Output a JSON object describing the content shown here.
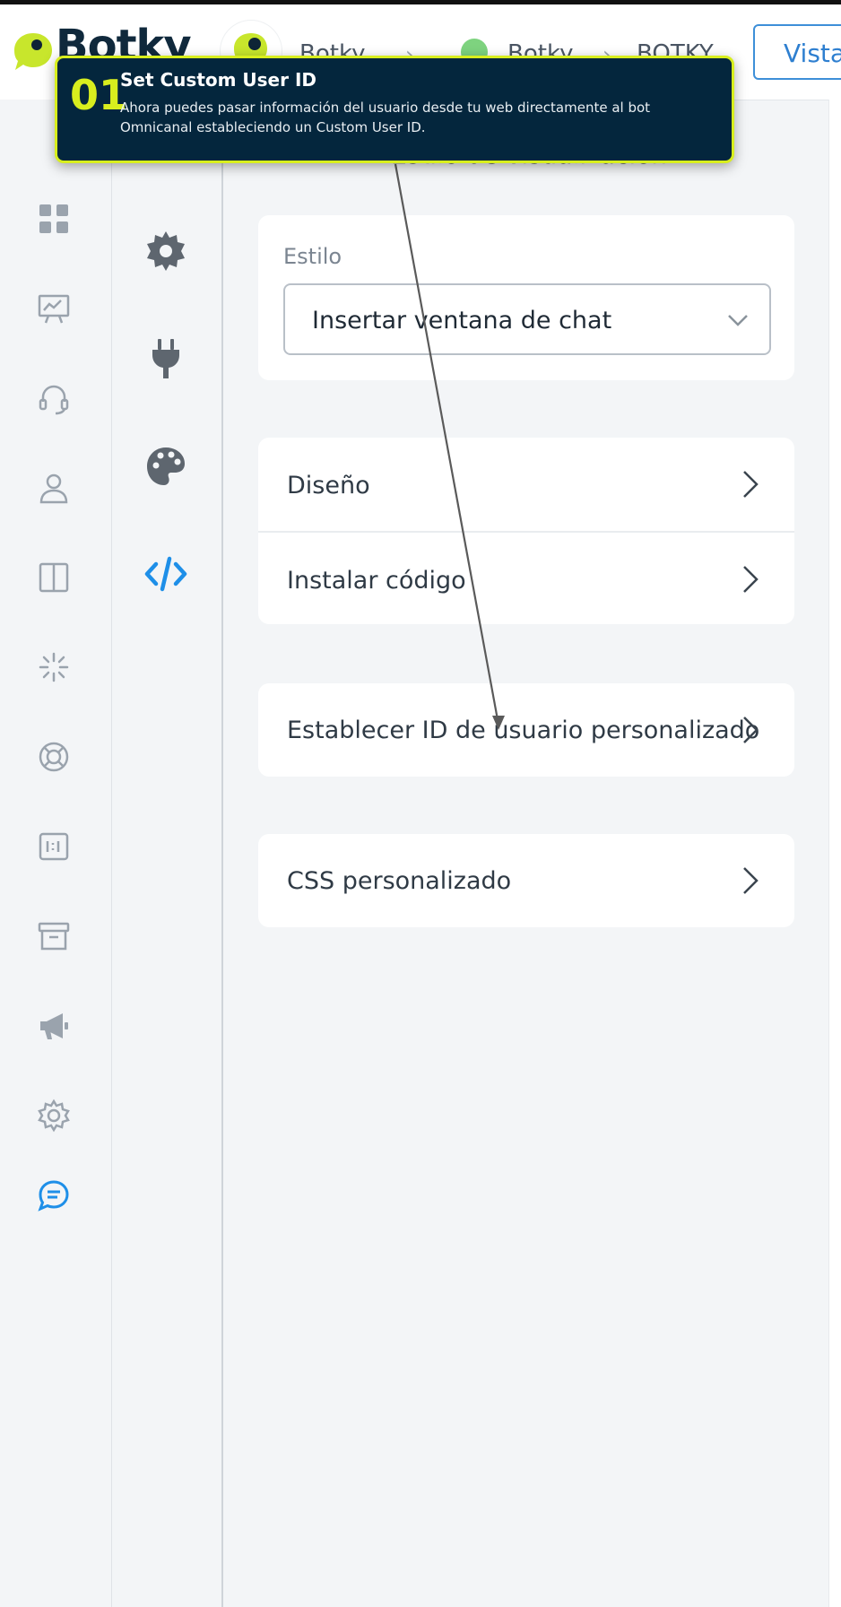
{
  "topbar": {
    "logo_text": "Botky",
    "breadcrumb": [
      "Botky",
      "Botky",
      "BOTKY"
    ],
    "vista_button": "Vista"
  },
  "tooltip": {
    "number": "01",
    "title": "Set Custom User ID",
    "body": "Ahora puedes pasar información del usuario desde tu web directamente al bot Omnicanal estableciendo un Custom User ID."
  },
  "main": {
    "section_title": "Estilo de visualización",
    "style_label": "Estilo",
    "style_value": "Insertar ventana de chat",
    "rows": {
      "design": "Diseño",
      "install_code": "Instalar código",
      "custom_user_id": "Establecer ID de usuario personalizado",
      "custom_css": "CSS personalizado"
    }
  },
  "sidebar1": {
    "items": [
      "grid-icon",
      "presentation-icon",
      "headset-icon",
      "user-icon",
      "columns-icon",
      "sparkle-icon",
      "lifebuoy-icon",
      "id-card-icon",
      "archive-icon",
      "megaphone-icon",
      "gear-icon",
      "chat-bubble-icon"
    ],
    "active": "chat-bubble-icon"
  },
  "sidebar2": {
    "items": [
      "settings-icon",
      "plug-icon",
      "palette-icon",
      "code-icon"
    ],
    "active": "code-icon"
  },
  "colors": {
    "accent_blue": "#1e8fe8",
    "tooltip_bg": "#04263d",
    "tooltip_accent": "#d8ee1e",
    "brand_green": "#c8e62c"
  }
}
